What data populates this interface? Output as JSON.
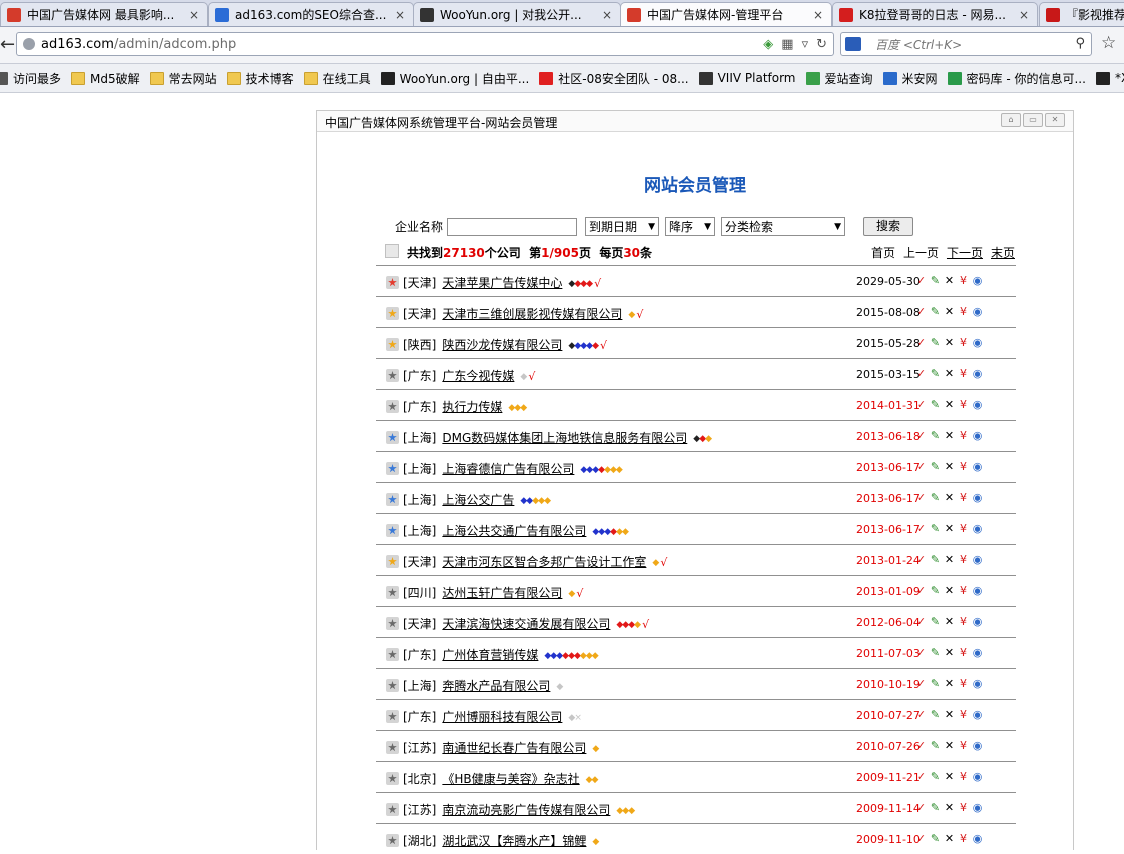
{
  "tabs": [
    {
      "title": "中国广告媒体网 最具影响...",
      "active": false,
      "icon": "chrome-like-icon"
    },
    {
      "title": "ad163.com的SEO综合查...",
      "active": false,
      "icon": "chart-icon"
    },
    {
      "title": "WooYun.org | 对我公开...",
      "active": false,
      "icon": "wooyun-icon"
    },
    {
      "title": "中国广告媒体网-管理平台",
      "active": true,
      "icon": "chrome-like-icon"
    },
    {
      "title": "K8拉登哥哥的日志 - 网易...",
      "active": false,
      "icon": "netease-icon"
    },
    {
      "title": "『影视推荐",
      "active": false,
      "icon": "red-seal-icon"
    }
  ],
  "tab_close": "×",
  "address": {
    "host": "ad163.com",
    "path": "/admin/adcom.php"
  },
  "search": {
    "placeholder": "百度 <Ctrl+K>"
  },
  "bookmarks": [
    {
      "label": "访问最多",
      "icon": "gear-icon"
    },
    {
      "label": "Md5破解",
      "icon": "folder-icon"
    },
    {
      "label": "常去网站",
      "icon": "folder-icon"
    },
    {
      "label": "技术博客",
      "icon": "folder-icon"
    },
    {
      "label": "在线工具",
      "icon": "folder-icon"
    },
    {
      "label": "WooYun.org | 自由平...",
      "icon": "wooyun-icon"
    },
    {
      "label": "社区-08安全团队 - 08...",
      "icon": "08-icon"
    },
    {
      "label": "VIIV Platform",
      "icon": "code-icon"
    },
    {
      "label": "爱站查询",
      "icon": "aizhan-icon"
    },
    {
      "label": "米安网",
      "icon": "m-icon"
    },
    {
      "label": "密码库 - 你的信息可...",
      "icon": "key-icon"
    },
    {
      "label": "*XSS",
      "icon": "xss-icon"
    }
  ],
  "panel": {
    "title": "中国广告媒体网系统管理平台-网站会员管理",
    "heading": "网站会员管理"
  },
  "filter": {
    "company_label": "企业名称",
    "sort_field": "到期日期",
    "sort_order": "降序",
    "category": "分类检索",
    "search_button": "搜索"
  },
  "summary": {
    "found_prefix": "共找到",
    "total": "27130",
    "found_suffix": "个公司",
    "page_prefix": "第",
    "page": "1/905",
    "page_suffix": "页",
    "per_page_prefix": "每页",
    "per_page": "30",
    "per_page_suffix": "条"
  },
  "pager": {
    "first": "首页",
    "prev": "上一页",
    "next": "下一页",
    "last": "末页"
  },
  "rows": [
    {
      "star": "red",
      "prov": "[天津]",
      "name": "天津苹果广告传媒中心",
      "badges": [
        [
          "k",
          "◆"
        ],
        [
          "r",
          "◆◆◆"
        ]
      ],
      "check": true,
      "date": "2029-05-30",
      "expired": false
    },
    {
      "star": "gold",
      "prov": "[天津]",
      "name": "天津市三维创展影视传媒有限公司",
      "badges": [
        [
          "g",
          "◆"
        ]
      ],
      "check": true,
      "date": "2015-08-08",
      "expired": false
    },
    {
      "star": "gold",
      "prov": "[陕西]",
      "name": "陕西沙龙传媒有限公司",
      "badges": [
        [
          "k",
          "◆"
        ],
        [
          "b",
          "◆◆◆"
        ],
        [
          "r",
          "◆"
        ]
      ],
      "check": true,
      "date": "2015-05-28",
      "expired": false
    },
    {
      "star": "grey",
      "prov": "[广东]",
      "name": "广东今视传媒",
      "badges": [
        [
          "w",
          "◆"
        ]
      ],
      "check": true,
      "date": "2015-03-15",
      "expired": false
    },
    {
      "star": "grey",
      "prov": "[广东]",
      "name": "执行力传媒",
      "badges": [
        [
          "g",
          "◆◆◆"
        ]
      ],
      "check": false,
      "date": "2014-01-31",
      "expired": true
    },
    {
      "star": "blue",
      "prov": "[上海]",
      "name": "DMG数码媒体集团上海地铁信息服务有限公司",
      "badges": [
        [
          "k",
          "◆"
        ],
        [
          "r",
          "◆"
        ],
        [
          "g",
          "◆"
        ]
      ],
      "check": false,
      "date": "2013-06-18",
      "expired": true
    },
    {
      "star": "blue",
      "prov": "[上海]",
      "name": "上海睿德信广告有限公司",
      "badges": [
        [
          "b",
          "◆◆◆"
        ],
        [
          "r",
          "◆"
        ],
        [
          "g",
          "◆◆◆"
        ]
      ],
      "check": false,
      "date": "2013-06-17",
      "expired": true
    },
    {
      "star": "blue",
      "prov": "[上海]",
      "name": "上海公交广告",
      "badges": [
        [
          "b",
          "◆◆"
        ],
        [
          "g",
          "◆◆◆"
        ]
      ],
      "check": false,
      "date": "2013-06-17",
      "expired": true
    },
    {
      "star": "blue",
      "prov": "[上海]",
      "name": "上海公共交通广告有限公司",
      "badges": [
        [
          "b",
          "◆◆◆"
        ],
        [
          "r",
          "◆"
        ],
        [
          "g",
          "◆◆"
        ]
      ],
      "check": false,
      "date": "2013-06-17",
      "expired": true
    },
    {
      "star": "gold",
      "prov": "[天津]",
      "name": "天津市河东区智合多邦广告设计工作室",
      "badges": [
        [
          "g",
          "◆"
        ]
      ],
      "check": true,
      "date": "2013-01-24",
      "expired": true
    },
    {
      "star": "grey",
      "prov": "[四川]",
      "name": "达州玉轩广告有限公司",
      "badges": [
        [
          "g",
          "◆"
        ]
      ],
      "check": true,
      "date": "2013-01-09",
      "expired": true
    },
    {
      "star": "grey",
      "prov": "[天津]",
      "name": "天津滨海快速交通发展有限公司",
      "badges": [
        [
          "r",
          "◆◆◆"
        ],
        [
          "g",
          "◆"
        ]
      ],
      "check": true,
      "date": "2012-06-04",
      "expired": true
    },
    {
      "star": "grey",
      "prov": "[广东]",
      "name": "广州体育营销传媒",
      "badges": [
        [
          "b",
          "◆◆◆"
        ],
        [
          "r",
          "◆◆◆"
        ],
        [
          "g",
          "◆◆◆"
        ]
      ],
      "check": false,
      "date": "2011-07-03",
      "expired": true
    },
    {
      "star": "grey",
      "prov": "[上海]",
      "name": "奔腾水产品有限公司",
      "badges": [
        [
          "w",
          "◆"
        ]
      ],
      "check": false,
      "date": "2010-10-19",
      "expired": true
    },
    {
      "star": "grey",
      "prov": "[广东]",
      "name": "广州博丽科技有限公司",
      "badges": [
        [
          "w",
          "◆"
        ],
        [
          "w",
          "×"
        ]
      ],
      "check": false,
      "date": "2010-07-27",
      "expired": true
    },
    {
      "star": "grey",
      "prov": "[江苏]",
      "name": "南通世纪长春广告有限公司",
      "badges": [
        [
          "g",
          "◆"
        ]
      ],
      "check": false,
      "date": "2010-07-26",
      "expired": true
    },
    {
      "star": "grey",
      "prov": "[北京]",
      "name": "《HB健康与美容》杂志社",
      "badges": [
        [
          "g",
          "◆◆"
        ]
      ],
      "check": false,
      "date": "2009-11-21",
      "expired": true
    },
    {
      "star": "grey",
      "prov": "[江苏]",
      "name": "南京流动亮影广告传媒有限公司",
      "badges": [
        [
          "g",
          "◆◆◆"
        ]
      ],
      "check": false,
      "date": "2009-11-14",
      "expired": true
    },
    {
      "star": "grey",
      "prov": "[湖北]",
      "name": "湖北武汉【奔腾水产】锦鲤",
      "badges": [
        [
          "g",
          "◆"
        ]
      ],
      "check": false,
      "date": "2009-11-10",
      "expired": true
    }
  ],
  "row_actions": [
    "✓",
    "✎",
    "✕",
    "¥",
    "◉"
  ],
  "check_mark": "√"
}
